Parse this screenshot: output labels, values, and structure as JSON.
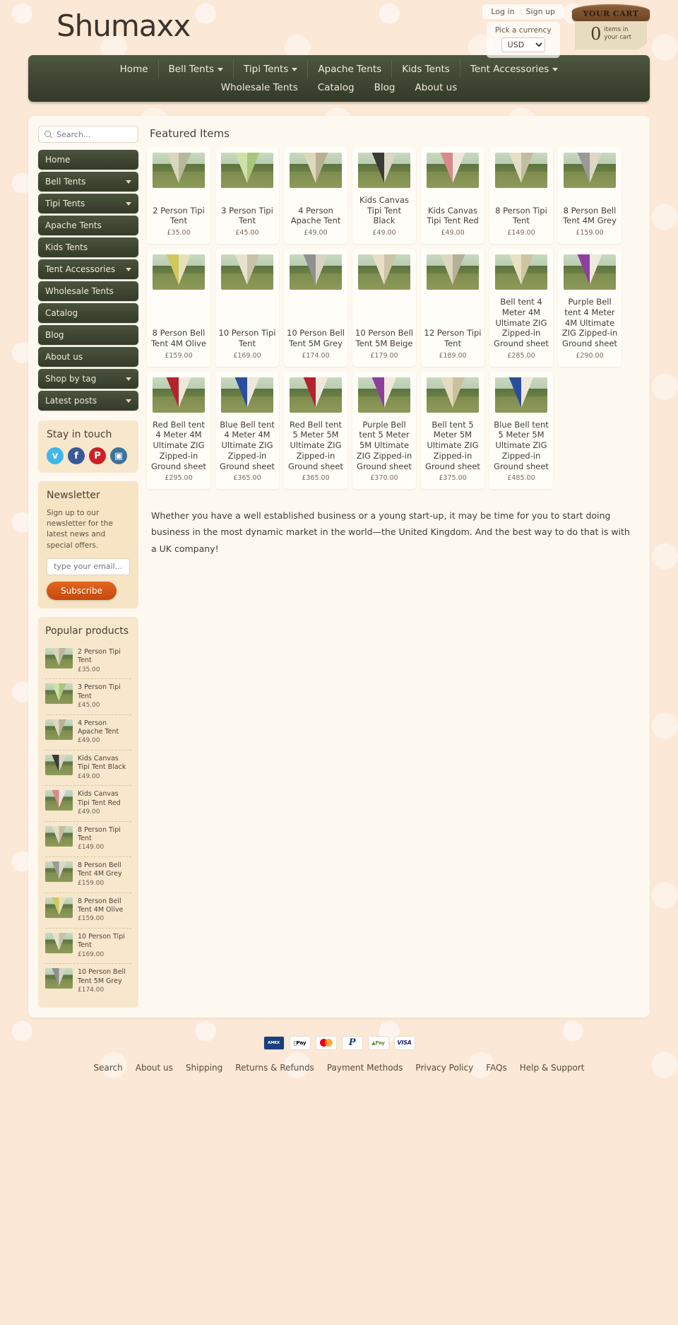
{
  "header": {
    "logo": "Shumaxx",
    "login": "Log in",
    "signup": "Sign up",
    "currency_label": "Pick a currency",
    "currency_value": "USD",
    "cart_title": "YOUR CART",
    "cart_count": "0",
    "cart_text_line1": "items in",
    "cart_text_line2": "your cart"
  },
  "nav": {
    "row1": [
      {
        "label": "Home",
        "caret": false
      },
      {
        "label": "Bell Tents",
        "caret": true
      },
      {
        "label": "Tipi Tents",
        "caret": true
      },
      {
        "label": "Apache Tents",
        "caret": false
      },
      {
        "label": "Kids Tents",
        "caret": false
      },
      {
        "label": "Tent Accessories",
        "caret": true
      }
    ],
    "row2": [
      {
        "label": "Wholesale Tents",
        "caret": false
      },
      {
        "label": "Catalog",
        "caret": false
      },
      {
        "label": "Blog",
        "caret": false
      },
      {
        "label": "About us",
        "caret": false
      }
    ]
  },
  "sidebar": {
    "search_placeholder": "Search...",
    "items": [
      {
        "label": "Home",
        "caret": false
      },
      {
        "label": "Bell Tents",
        "caret": true
      },
      {
        "label": "Tipi Tents",
        "caret": true
      },
      {
        "label": "Apache Tents",
        "caret": false
      },
      {
        "label": "Kids Tents",
        "caret": false
      },
      {
        "label": "Tent Accessories",
        "caret": true
      },
      {
        "label": "Wholesale Tents",
        "caret": false
      },
      {
        "label": "Catalog",
        "caret": false
      },
      {
        "label": "Blog",
        "caret": false
      },
      {
        "label": "About us",
        "caret": false
      },
      {
        "label": "Shop by tag",
        "caret": true
      },
      {
        "label": "Latest posts",
        "caret": true
      }
    ],
    "social_title": "Stay in touch",
    "social": [
      {
        "name": "twitter",
        "glyph": "ᴠ"
      },
      {
        "name": "facebook",
        "glyph": "f"
      },
      {
        "name": "pinterest",
        "glyph": "P"
      },
      {
        "name": "instagram",
        "glyph": "▣"
      }
    ],
    "newsletter_title": "Newsletter",
    "newsletter_text": "Sign up to our newsletter for the latest news and special offers.",
    "newsletter_placeholder": "type your email...",
    "subscribe_label": "Subscribe",
    "popular_title": "Popular products",
    "popular": [
      {
        "name": "2 Person Tipi Tent",
        "price": "£35.00",
        "img": "tipi2"
      },
      {
        "name": "3 Person Tipi Tent",
        "price": "£45.00",
        "img": "tipi3"
      },
      {
        "name": "4 Person Apache Tent",
        "price": "£49.00",
        "img": "apache4"
      },
      {
        "name": "Kids Canvas Tipi Tent Black",
        "price": "£49.00",
        "img": "kidsblack"
      },
      {
        "name": "Kids Canvas Tipi Tent Red",
        "price": "£49.00",
        "img": "kidsred"
      },
      {
        "name": "8 Person Tipi Tent",
        "price": "£149.00",
        "img": "tipi8"
      },
      {
        "name": "8 Person Bell Tent 4M Grey",
        "price": "£159.00",
        "img": "bell4grey"
      },
      {
        "name": "8 Person Bell Tent 4M Olive",
        "price": "£159.00",
        "img": "bell4olive"
      },
      {
        "name": "10 Person Tipi Tent",
        "price": "£169.00",
        "img": "tipi10"
      },
      {
        "name": "10 Person Bell Tent 5M Grey",
        "price": "£174.00",
        "img": "bell5grey"
      }
    ]
  },
  "main": {
    "title": "Featured Items",
    "products": [
      {
        "name": "2 Person Tipi Tent",
        "price": "£35.00",
        "img": "tipi2"
      },
      {
        "name": "3 Person Tipi Tent",
        "price": "£45.00",
        "img": "tipi3"
      },
      {
        "name": "4 Person Apache Tent",
        "price": "£49.00",
        "img": "apache4"
      },
      {
        "name": "Kids Canvas Tipi Tent Black",
        "price": "£49.00",
        "img": "kidsblack"
      },
      {
        "name": "Kids Canvas Tipi Tent Red",
        "price": "£49.00",
        "img": "kidsred"
      },
      {
        "name": "8 Person Tipi Tent",
        "price": "£149.00",
        "img": "tipi8"
      },
      {
        "name": "8 Person Bell Tent 4M Grey",
        "price": "£159.00",
        "img": "bell4grey"
      },
      {
        "name": "8 Person Bell Tent 4M Olive",
        "price": "£159.00",
        "img": "bell4olive"
      },
      {
        "name": "10 Person Tipi Tent",
        "price": "£169.00",
        "img": "tipi10"
      },
      {
        "name": "10 Person Bell Tent 5M Grey",
        "price": "£174.00",
        "img": "bell5grey"
      },
      {
        "name": "10 Person Bell Tent 5M Beige",
        "price": "£179.00",
        "img": "bell5beige"
      },
      {
        "name": "12 Person Tipi Tent",
        "price": "£189.00",
        "img": "tipi12"
      },
      {
        "name": "Bell tent 4 Meter 4M Ultimate ZIG Zipped-in Ground sheet",
        "price": "£285.00",
        "img": "zig4beige"
      },
      {
        "name": "Purple Bell tent 4 Meter 4M Ultimate ZIG Zipped-in Ground sheet",
        "price": "£290.00",
        "img": "zig4purple"
      },
      {
        "name": "Red Bell tent 4 Meter 4M Ultimate ZIG Zipped-in Ground sheet",
        "price": "£295.00",
        "img": "zig4red"
      },
      {
        "name": "Blue Bell tent 4 Meter 4M Ultimate ZIG Zipped-in Ground sheet",
        "price": "£365.00",
        "img": "zig4blue"
      },
      {
        "name": "Red Bell tent 5 Meter 5M Ultimate ZIG Zipped-in Ground sheet",
        "price": "£365.00",
        "img": "zig5red"
      },
      {
        "name": "Purple Bell tent 5 Meter 5M Ultimate ZIG Zipped-in Ground sheet",
        "price": "£370.00",
        "img": "zig5purple"
      },
      {
        "name": "Bell tent 5 Meter 5M Ultimate ZIG Zipped-in Ground sheet",
        "price": "£375.00",
        "img": "zig5beige"
      },
      {
        "name": "Blue Bell tent 5 Meter 5M Ultimate ZIG Zipped-in Ground sheet",
        "price": "£485.00",
        "img": "zig5blue"
      }
    ],
    "blurb": "Whether you have a well established business or a young start-up, it may be time for you to start doing business in the most dynamic market in the world—the United Kingdom. And the best way to do that is with a UK company!"
  },
  "footer": {
    "payments": [
      "AMEX",
      "Pay",
      "mastercard",
      "PayPal",
      "GPay",
      "VISA"
    ],
    "links": [
      "Search",
      "About us",
      "Shipping",
      "Returns & Refunds",
      "Payment Methods",
      "Privacy Policy",
      "FAQs",
      "Help & Support"
    ]
  }
}
